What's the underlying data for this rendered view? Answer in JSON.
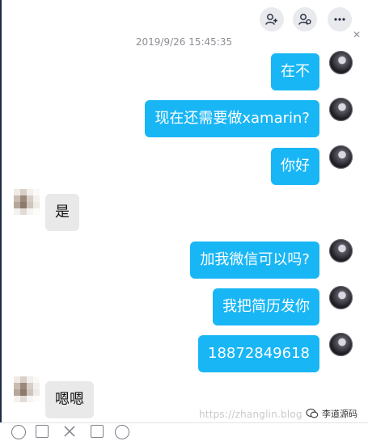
{
  "toolbar": {
    "add_contact_icon": "person-plus-icon",
    "contact_settings_icon": "person-gear-icon",
    "more_icon": "ellipsis-icon",
    "close_icon": "close-icon"
  },
  "chat": {
    "timestamp": "2019/9/26 15:45:35",
    "messages": [
      {
        "side": "right",
        "text": "在不"
      },
      {
        "side": "right",
        "text": "现在还需要做xamarin?"
      },
      {
        "side": "right",
        "text": "你好"
      },
      {
        "side": "left",
        "text": "是"
      },
      {
        "side": "right",
        "text": "加我微信可以吗?"
      },
      {
        "side": "right",
        "text": "我把简历发你"
      },
      {
        "side": "right",
        "text": "18872849618"
      },
      {
        "side": "left",
        "text": "嗯嗯"
      }
    ]
  },
  "watermark": {
    "url": "https://zhanglin.blog",
    "wechat_label": "李道源码"
  },
  "colors": {
    "bubble_blue": "#19b6f5",
    "bubble_gray": "#e9e9ea"
  }
}
